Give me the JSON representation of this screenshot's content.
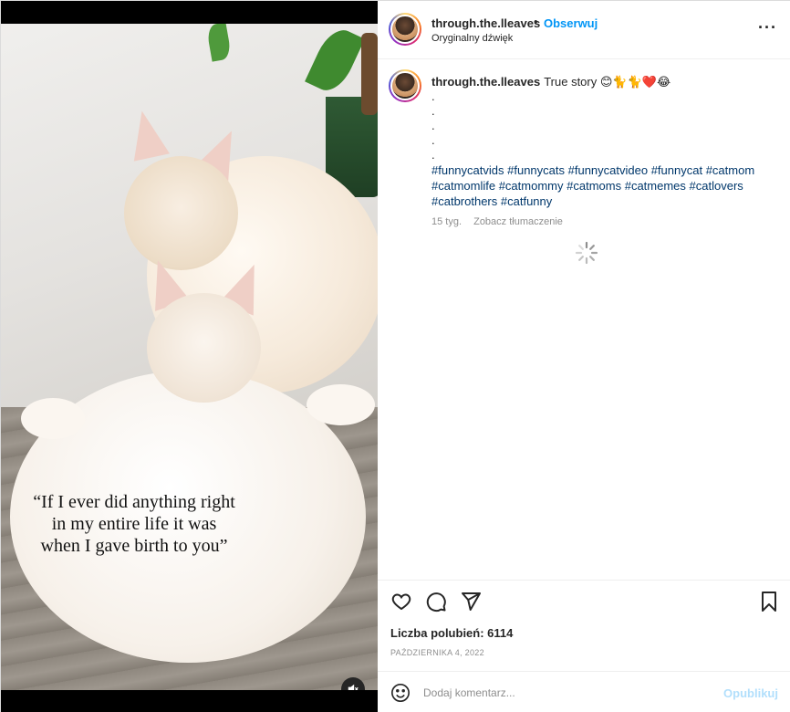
{
  "media": {
    "caption_lines": [
      "“If I ever did anything right",
      "in my entire life it was",
      "when I gave birth to you”"
    ],
    "mute_icon": "speaker-muted-icon"
  },
  "header": {
    "username": "through.the.lleaves",
    "separator": "•",
    "follow_label": "Obserwuj",
    "audio_label": "Oryginalny dźwięk",
    "more_icon": "more-options-icon"
  },
  "post": {
    "username": "through.the.lleaves",
    "text": "True story 😊🐈🐈❤️😂",
    "dots": [
      ".",
      ".",
      ".",
      ".",
      "."
    ],
    "hashtags": [
      "#funnycatvids",
      "#funnycats",
      "#funnycatvideo",
      "#funnycat",
      "#catmom",
      "#catmomlife",
      "#catmommy",
      "#catmoms",
      "#catmemes",
      "#catlovers",
      "#catbrothers",
      "#catfunny"
    ],
    "time_ago": "15 tyg.",
    "translate_label": "Zobacz tłumaczenie"
  },
  "actions": {
    "likes_label": "Liczba polubień: 6114",
    "date": "PAŹDZIERNIKA 4, 2022",
    "icons": [
      "heart-icon",
      "comment-icon",
      "share-icon",
      "bookmark-icon"
    ]
  },
  "comment": {
    "placeholder": "Dodaj komentarz...",
    "post_label": "Opublikuj",
    "post_color": "#b2dffc"
  },
  "colors": {
    "accent": "#0095f6",
    "hashtag": "#00376b",
    "muted": "#8e8e8e"
  }
}
